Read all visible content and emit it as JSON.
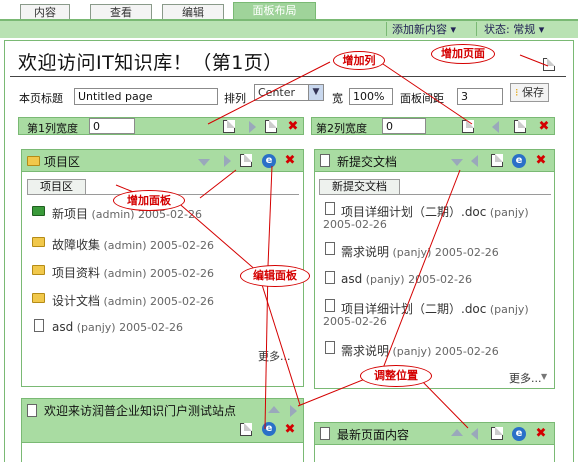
{
  "tabs": [
    "内容",
    "查看",
    "编辑",
    "面板布局"
  ],
  "menu": {
    "add_content": "添加新内容 ▾",
    "status": "状态: 常规 ▾"
  },
  "page": {
    "title": "欢迎访问IT知识库！（第1页）",
    "title_label": "本页标题",
    "title_value": "Untitled page",
    "align_label": "排列",
    "align_value": "Center",
    "width_label": "宽",
    "width_value": "100%",
    "spacing_label": "面板间距",
    "spacing_value": "3",
    "save_label": "保存"
  },
  "columns": [
    {
      "label": "第1列宽度",
      "value": "0"
    },
    {
      "label": "第2列宽度",
      "value": "0"
    }
  ],
  "panels": {
    "project": {
      "title": "项目区",
      "subtab": "项目区",
      "items": [
        {
          "name": "新项目",
          "meta": "(admin) 2005-02-26"
        },
        {
          "name": "故障收集",
          "meta": "(admin) 2005-02-26"
        },
        {
          "name": "项目资料",
          "meta": "(admin) 2005-02-26"
        },
        {
          "name": "设计文档",
          "meta": "(admin) 2005-02-26"
        },
        {
          "name": "asd",
          "meta": "(panjy) 2005-02-26"
        }
      ],
      "more": "更多..."
    },
    "newdocs": {
      "title": "新提交文档",
      "subtab": "新提交文档",
      "items": [
        {
          "name": "项目详细计划（二期）.doc",
          "meta": "(panjy)",
          "date": "2005-02-26"
        },
        {
          "name": "需求说明",
          "meta": "(panjy) 2005-02-26"
        },
        {
          "name": "asd",
          "meta": "(panjy) 2005-02-26"
        },
        {
          "name": "项目详细计划（二期）.doc",
          "meta": "(panjy)",
          "date": "2005-02-26"
        },
        {
          "name": "需求说明",
          "meta": "(panjy) 2005-02-26"
        }
      ],
      "more": "更多..."
    },
    "welcome": {
      "title": "欢迎来访润普企业知识门户测试站点"
    },
    "latest": {
      "title": "最新页面内容"
    }
  },
  "callouts": {
    "add_page": "增加页面",
    "add_column": "增加列",
    "add_panel": "增加面板",
    "edit_panel": "编辑面板",
    "adjust_position": "调整位置"
  },
  "colors": {
    "accent_green": "#a9dca2",
    "annotation_red": "#d40000",
    "ie_blue": "#2a70c8"
  }
}
